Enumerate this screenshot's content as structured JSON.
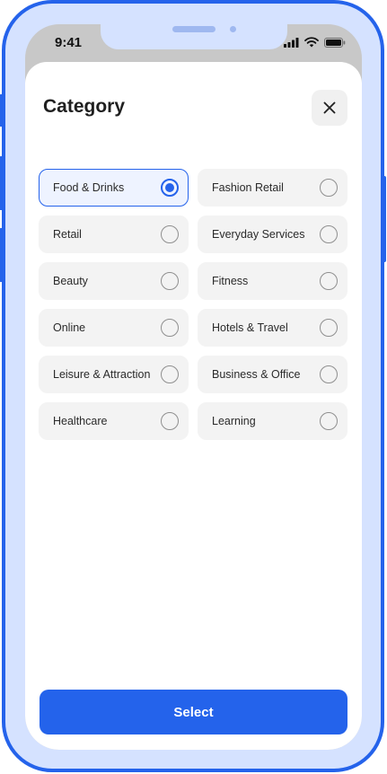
{
  "status_bar": {
    "time": "9:41"
  },
  "sheet": {
    "title": "Category",
    "close_icon": "close-icon"
  },
  "categories": [
    {
      "label": "Food & Drinks",
      "selected": true
    },
    {
      "label": "Fashion Retail",
      "selected": false
    },
    {
      "label": "Retail",
      "selected": false
    },
    {
      "label": "Everyday Services",
      "selected": false
    },
    {
      "label": "Beauty",
      "selected": false
    },
    {
      "label": "Fitness",
      "selected": false
    },
    {
      "label": "Online",
      "selected": false
    },
    {
      "label": "Hotels & Travel",
      "selected": false
    },
    {
      "label": "Leisure & Attraction",
      "selected": false
    },
    {
      "label": "Business & Office",
      "selected": false
    },
    {
      "label": "Healthcare",
      "selected": false
    },
    {
      "label": "Learning",
      "selected": false
    }
  ],
  "actions": {
    "select_label": "Select"
  },
  "colors": {
    "accent": "#2563eb",
    "frame_fill": "#d5e2ff",
    "option_bg": "#f3f3f3",
    "selected_bg": "#eef3ff"
  }
}
